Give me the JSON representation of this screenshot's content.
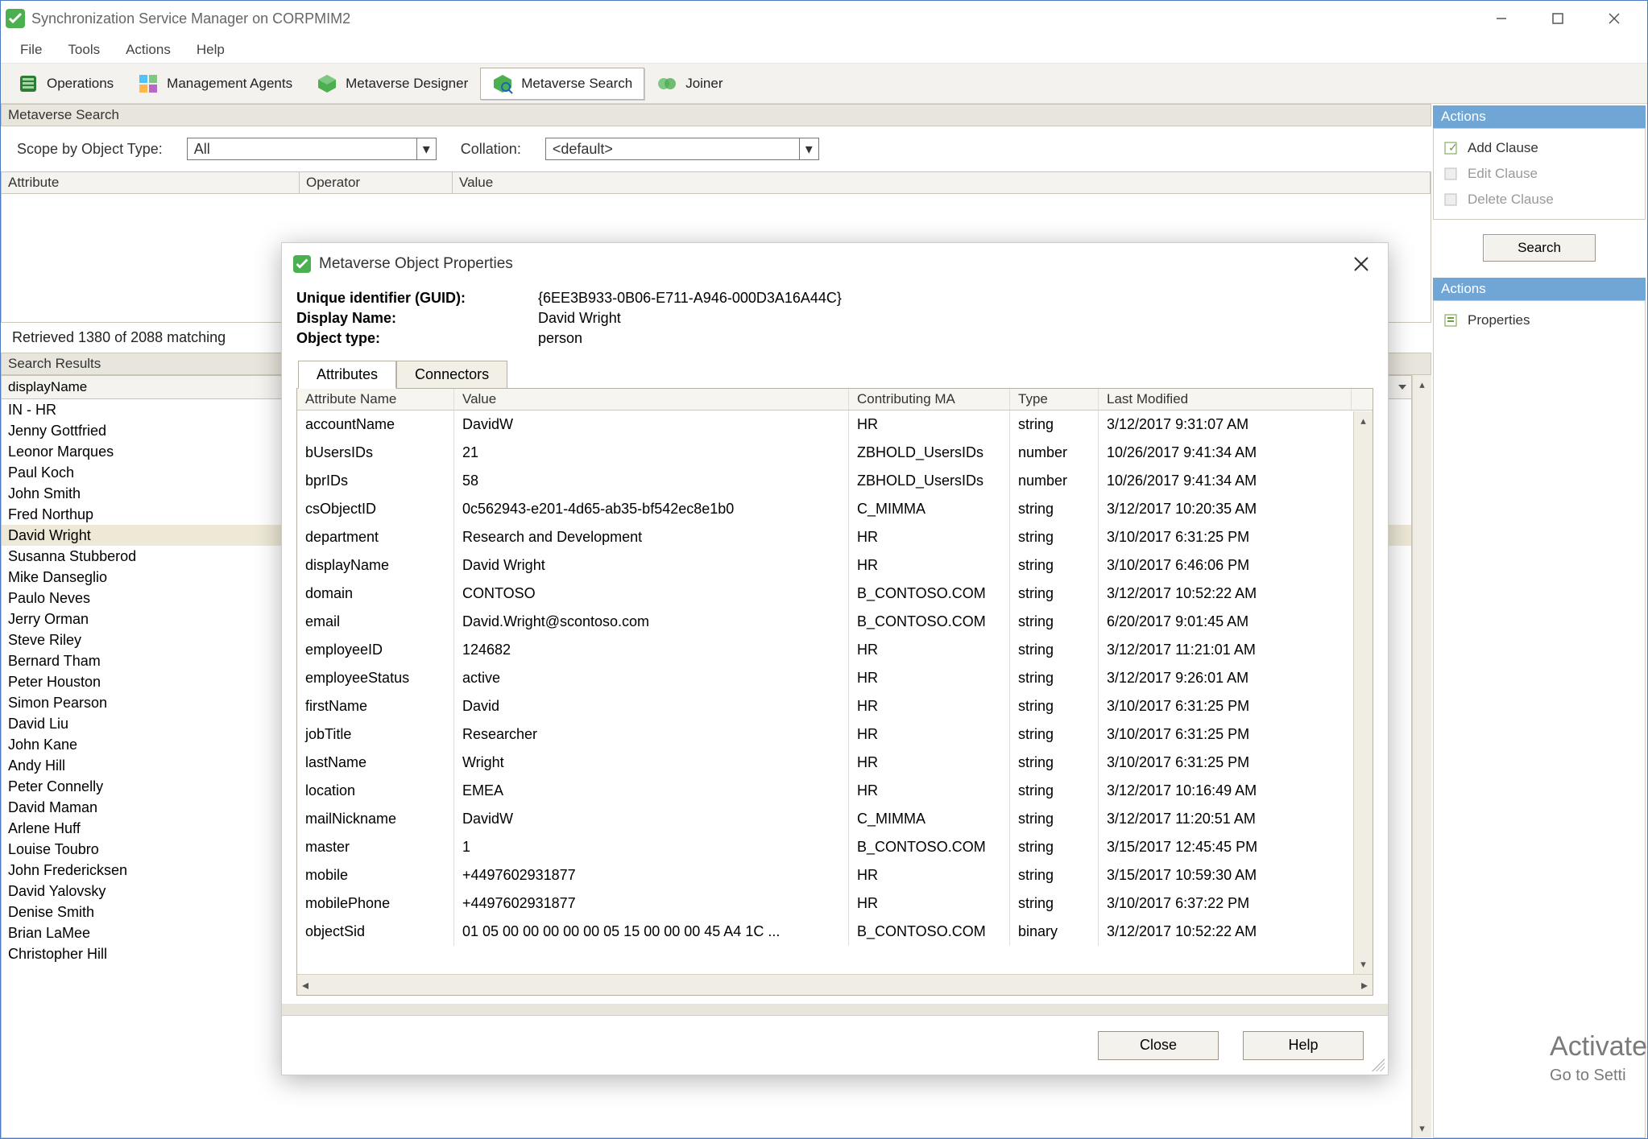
{
  "window": {
    "title": "Synchronization Service Manager on CORPMIM2"
  },
  "menu": {
    "file": "File",
    "tools": "Tools",
    "actions": "Actions",
    "help": "Help"
  },
  "toolbar": {
    "operations": "Operations",
    "management_agents": "Management Agents",
    "metaverse_designer": "Metaverse Designer",
    "metaverse_search": "Metaverse Search",
    "joiner": "Joiner"
  },
  "search_section": {
    "header": "Metaverse Search",
    "scope_label": "Scope by Object Type:",
    "scope_value": "All",
    "collation_label": "Collation:",
    "collation_value": "<default>",
    "grid_headers": {
      "attribute": "Attribute",
      "operator": "Operator",
      "value": "Value"
    },
    "status": "Retrieved 1380 of 2088 matching"
  },
  "actions_pane1": {
    "title": "Actions",
    "add": "Add Clause",
    "edit": "Edit Clause",
    "delete": "Delete Clause",
    "search_btn": "Search"
  },
  "actions_pane2": {
    "title": "Actions",
    "properties": "Properties"
  },
  "results": {
    "header": "Search Results",
    "col": "displayName",
    "selected": "David Wright",
    "items": [
      "IN - HR",
      "Jenny Gottfried",
      "Leonor Marques",
      "Paul Koch",
      "John Smith",
      "Fred Northup",
      "David Wright",
      "Susanna Stubberod",
      "Mike Danseglio",
      "Paulo Neves",
      "Jerry Orman",
      "Steve Riley",
      "Bernard Tham",
      "Peter Houston",
      "Simon Pearson",
      "David Liu",
      "John Kane",
      "Andy Hill",
      "Peter Connelly",
      "David Maman",
      "Arlene Huff",
      "Louise Toubro",
      "John Fredericksen",
      "David Yalovsky",
      "Denise Smith",
      "Brian LaMee",
      "Christopher Hill"
    ]
  },
  "dialog": {
    "title": "Metaverse Object Properties",
    "guid_label": "Unique identifier (GUID):",
    "guid": "{6EE3B933-0B06-E711-A946-000D3A16A44C}",
    "dn_label": "Display Name:",
    "dn": "David Wright",
    "ot_label": "Object type:",
    "ot": "person",
    "tabs": {
      "attributes": "Attributes",
      "connectors": "Connectors"
    },
    "columns": {
      "name": "Attribute Name",
      "value": "Value",
      "ma": "Contributing MA",
      "type": "Type",
      "mod": "Last Modified"
    },
    "rows": [
      {
        "n": "accountName",
        "v": "DavidW",
        "m": "HR",
        "t": "string",
        "d": "3/12/2017 9:31:07 AM"
      },
      {
        "n": "bUsersIDs",
        "v": "21",
        "m": "ZBHOLD_UsersIDs",
        "t": "number",
        "d": "10/26/2017 9:41:34 AM"
      },
      {
        "n": "bprIDs",
        "v": "58",
        "m": "ZBHOLD_UsersIDs",
        "t": "number",
        "d": "10/26/2017 9:41:34 AM"
      },
      {
        "n": "csObjectID",
        "v": "0c562943-e201-4d65-ab35-bf542ec8e1b0",
        "m": "C_MIMMA",
        "t": "string",
        "d": "3/12/2017 10:20:35 AM"
      },
      {
        "n": "department",
        "v": "Research and Development",
        "m": "HR",
        "t": "string",
        "d": "3/10/2017 6:31:25 PM"
      },
      {
        "n": "displayName",
        "v": "David Wright",
        "m": "HR",
        "t": "string",
        "d": "3/10/2017 6:46:06 PM"
      },
      {
        "n": "domain",
        "v": "CONTOSO",
        "m": "B_CONTOSO.COM",
        "t": "string",
        "d": "3/12/2017 10:52:22 AM"
      },
      {
        "n": "email",
        "v": "David.Wright@scontoso.com",
        "m": "B_CONTOSO.COM",
        "t": "string",
        "d": "6/20/2017 9:01:45 AM"
      },
      {
        "n": "employeeID",
        "v": "124682",
        "m": "HR",
        "t": "string",
        "d": "3/12/2017 11:21:01 AM"
      },
      {
        "n": "employeeStatus",
        "v": "active",
        "m": "HR",
        "t": "string",
        "d": "3/12/2017 9:26:01 AM"
      },
      {
        "n": "firstName",
        "v": "David",
        "m": "HR",
        "t": "string",
        "d": "3/10/2017 6:31:25 PM"
      },
      {
        "n": "jobTitle",
        "v": "Researcher",
        "m": "HR",
        "t": "string",
        "d": "3/10/2017 6:31:25 PM"
      },
      {
        "n": "lastName",
        "v": "Wright",
        "m": "HR",
        "t": "string",
        "d": "3/10/2017 6:31:25 PM"
      },
      {
        "n": "location",
        "v": "EMEA",
        "m": "HR",
        "t": "string",
        "d": "3/12/2017 10:16:49 AM"
      },
      {
        "n": "mailNickname",
        "v": "DavidW",
        "m": "C_MIMMA",
        "t": "string",
        "d": "3/12/2017 11:20:51 AM"
      },
      {
        "n": "master",
        "v": "1",
        "m": "B_CONTOSO.COM",
        "t": "string",
        "d": "3/15/2017 12:45:45 PM"
      },
      {
        "n": "mobile",
        "v": "+4497602931877",
        "m": "HR",
        "t": "string",
        "d": "3/15/2017 10:59:30 AM"
      },
      {
        "n": "mobilePhone",
        "v": "+4497602931877",
        "m": "HR",
        "t": "string",
        "d": "3/10/2017 6:37:22 PM"
      },
      {
        "n": "objectSid",
        "v": "01 05 00 00 00 00 00 05 15 00 00 00 45 A4 1C ...",
        "m": "B_CONTOSO.COM",
        "t": "binary",
        "d": "3/12/2017 10:52:22 AM"
      }
    ],
    "close": "Close",
    "help": "Help"
  },
  "watermark": {
    "l1": "Activate",
    "l2": "Go to Setti"
  }
}
